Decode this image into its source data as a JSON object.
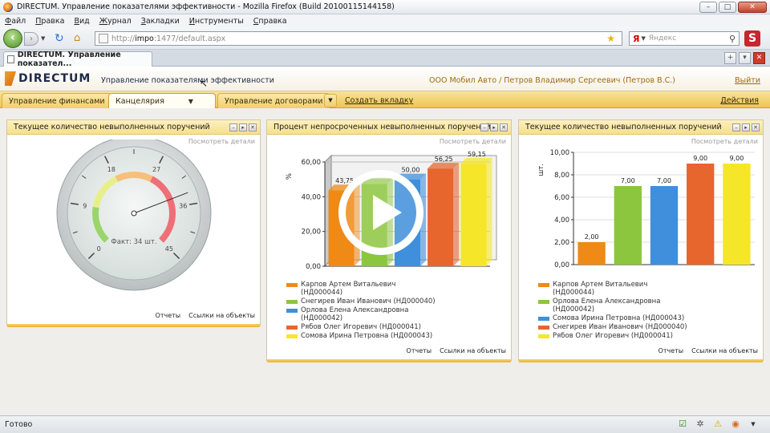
{
  "browser": {
    "title": "DIRECTUM. Управление показателями эффективности - Mozilla Firefox (Build 20100115144158)",
    "menu": [
      "Файл",
      "Правка",
      "Вид",
      "Журнал",
      "Закладки",
      "Инструменты",
      "Справка"
    ],
    "url_host": "http://",
    "url_bold": "impo",
    "url_rest": ":1477/default.aspx",
    "search_placeholder": "Яндекс",
    "search_engine": "Я",
    "tab_title": "DIRECTUM. Управление показател...",
    "status": "Готово"
  },
  "app": {
    "logo": "DIRECTUM",
    "title": "Управление показателями эффективности",
    "org_user": "ООО Мобил Авто / Петров Владимир Сергеевич (Петров В.С.)",
    "logout": "Выйти",
    "tabs": [
      "Управление финансами",
      "Канцелярия",
      "Управление договорами"
    ],
    "create_tab": "Создать вкладку",
    "actions": "Действия"
  },
  "widgets": {
    "gauge": {
      "title": "Текущее количество невыполненных поручений",
      "details": "Посмотреть детали",
      "fact_label": "Факт: 34 шт.",
      "ticks": [
        "0",
        "9",
        "18",
        "27",
        "36",
        "45"
      ],
      "value": 34,
      "max": 45,
      "footer": [
        "Отчеты",
        "Ссылки на объекты"
      ]
    },
    "percent": {
      "title": "Процент непросроченных невыполненных поручений",
      "details": "Посмотреть детали",
      "footer": [
        "Отчеты",
        "Ссылки на объекты"
      ]
    },
    "count": {
      "title": "Текущее количество невыполненных поручений",
      "details": "Посмотреть детали",
      "footer": [
        "Отчеты",
        "Ссылки на объекты"
      ]
    }
  },
  "chart_data": [
    {
      "type": "bar",
      "ylabel": "%",
      "ylim": [
        0,
        60
      ],
      "yticks": [
        "0,00",
        "20,00",
        "40,00",
        "60,00"
      ],
      "categories": [
        "Карпов Артем Витальевич (НД000044)",
        "Снегирев Иван Иванович (НД000040)",
        "Орлова Елена Александровна (НД000042)",
        "Рябов Олег Игоревич (НД000041)",
        "Сомова Ирина Петровна (НД000043)"
      ],
      "values": [
        43.75,
        47.38,
        50.0,
        56.25,
        59.15
      ],
      "labels": [
        "43,75",
        "47,38",
        "50,00",
        "56,25",
        "59,15"
      ],
      "colors": [
        "#ef8a17",
        "#8cc63f",
        "#3f8fdc",
        "#e6662e",
        "#f6e62a"
      ]
    },
    {
      "type": "bar",
      "ylabel": "шт.",
      "ylim": [
        0,
        10
      ],
      "yticks": [
        "0,00",
        "2,00",
        "4,00",
        "6,00",
        "8,00",
        "10,00"
      ],
      "categories": [
        "Карпов Артем Витальевич (НД000044)",
        "Орлова Елена Александровна (НД000042)",
        "Сомова Ирина Петровна (НД000043)",
        "Снегирев Иван Иванович (НД000040)",
        "Рябов Олег Игоревич (НД000041)"
      ],
      "values": [
        2,
        7,
        7,
        9,
        9
      ],
      "labels": [
        "2,00",
        "7,00",
        "7,00",
        "9,00",
        "9,00"
      ],
      "colors": [
        "#ef8a17",
        "#8cc63f",
        "#3f8fdc",
        "#e6662e",
        "#f6e62a"
      ]
    }
  ]
}
